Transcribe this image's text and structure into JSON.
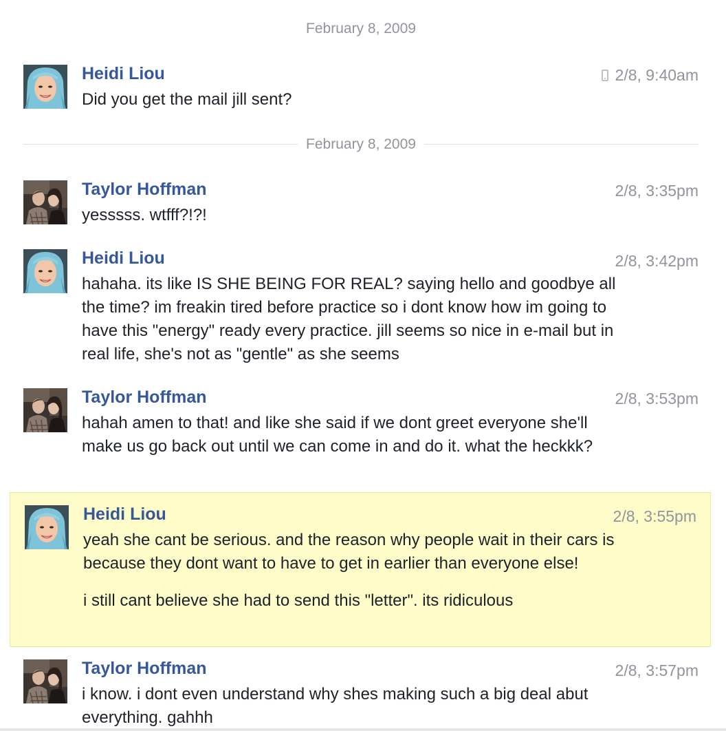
{
  "thread": {
    "top_date": "February 8, 2009",
    "divider_date": "February 8, 2009",
    "messages": [
      {
        "sender": "Heidi Liou",
        "time": "2/8, 9:40am",
        "paragraphs": [
          "Did you get the mail jill sent?"
        ],
        "mobile": true,
        "avatar": "heidi"
      },
      {
        "sender": "Taylor Hoffman",
        "time": "2/8, 3:35pm",
        "paragraphs": [
          "yesssss. wtfff?!?!"
        ],
        "mobile": false,
        "avatar": "taylor"
      },
      {
        "sender": "Heidi Liou",
        "time": "2/8, 3:42pm",
        "paragraphs": [
          "hahaha. its like IS SHE BEING FOR REAL? saying hello and goodbye all the time? im freakin tired before practice so i dont know how im going to have this \"energy\" ready every practice. jill seems so nice in e-mail but in real life, she's not as \"gentle\" as she seems"
        ],
        "mobile": false,
        "avatar": "heidi"
      },
      {
        "sender": "Taylor Hoffman",
        "time": "2/8, 3:53pm",
        "paragraphs": [
          "hahah amen to that!  and like she said if we dont greet everyone she'll make us go back out until we can come in and do it.  what the heckkk?"
        ],
        "mobile": false,
        "avatar": "taylor"
      },
      {
        "sender": "Heidi Liou",
        "time": "2/8, 3:55pm",
        "paragraphs": [
          "yeah she cant be serious. and the reason why people wait in their cars is because they dont want to have to get in earlier than everyone else!",
          "i still cant believe she had to send this \"letter\". its ridiculous"
        ],
        "mobile": false,
        "highlighted": true,
        "highlight_color": "#fefdc9",
        "avatar": "heidi"
      },
      {
        "sender": "Taylor Hoffman",
        "time": "2/8, 3:57pm",
        "paragraphs": [
          "i know. i dont even understand why shes making such a big deal abut everything. gahhh"
        ],
        "mobile": false,
        "avatar": "taylor"
      }
    ]
  },
  "colors": {
    "sender_name": "#365899",
    "timestamp": "#90949c",
    "body_text": "#1d2129",
    "highlight": "#fefdc9"
  },
  "icons": {
    "mobile_indicator": "mobile-phone-icon"
  }
}
